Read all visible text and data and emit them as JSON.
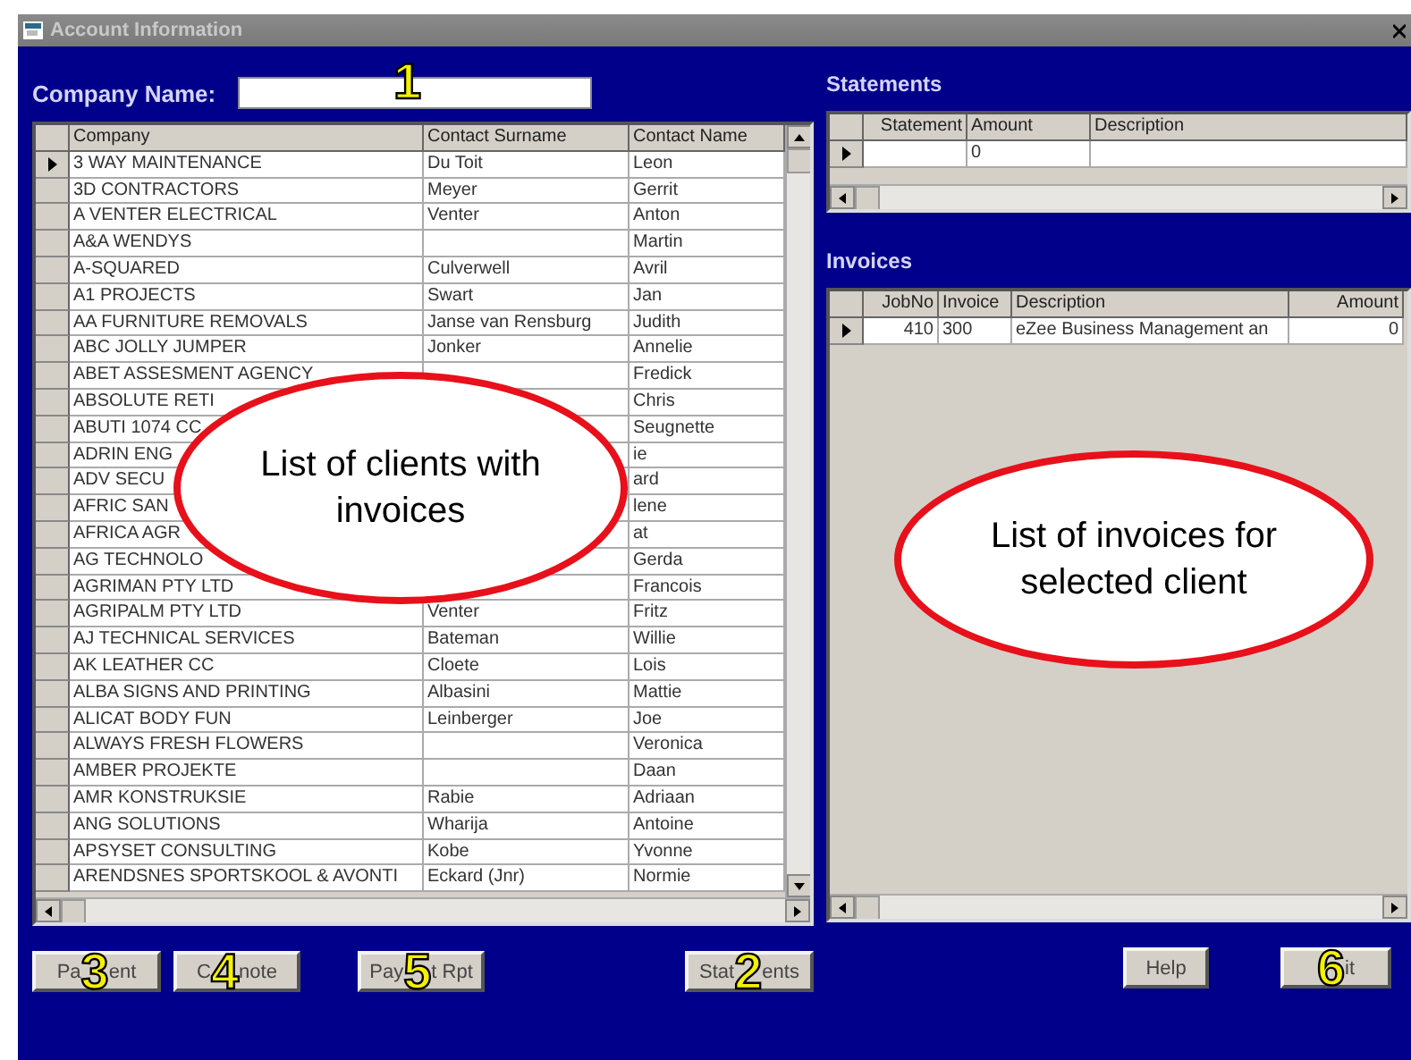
{
  "window": {
    "title": "Account Information"
  },
  "company_name": {
    "label": "Company Name:",
    "marker": "1"
  },
  "clients": {
    "columns": [
      "Company",
      "Contact Surname",
      "Contact Name"
    ],
    "rows": [
      {
        "company": "3 WAY MAINTENANCE",
        "surname": "Du Toit",
        "name": "Leon",
        "selected": true
      },
      {
        "company": "3D CONTRACTORS",
        "surname": "Meyer",
        "name": "Gerrit",
        "selected": false
      },
      {
        "company": "A VENTER ELECTRICAL",
        "surname": "Venter",
        "name": "Anton",
        "selected": false
      },
      {
        "company": "A&A WENDYS",
        "surname": "",
        "name": "Martin",
        "selected": false
      },
      {
        "company": "A-SQUARED",
        "surname": "Culverwell",
        "name": "Avril",
        "selected": false
      },
      {
        "company": "A1 PROJECTS",
        "surname": "Swart",
        "name": "Jan",
        "selected": false
      },
      {
        "company": "AA FURNITURE REMOVALS",
        "surname": "Janse van Rensburg",
        "name": "Judith",
        "selected": false
      },
      {
        "company": "ABC JOLLY JUMPER",
        "surname": "Jonker",
        "name": "Annelie",
        "selected": false
      },
      {
        "company": "ABET ASSESMENT AGENCY",
        "surname": "",
        "name": "Fredick",
        "selected": false
      },
      {
        "company": "ABSOLUTE RETI",
        "surname": "",
        "name": "Chris",
        "selected": false
      },
      {
        "company": "ABUTI 1074 CC",
        "surname": "",
        "name": "Seugnette",
        "selected": false
      },
      {
        "company": "ADRIN ENG",
        "surname": "",
        "name": "ie",
        "selected": false
      },
      {
        "company": "ADV SECU",
        "surname": "",
        "name": "ard",
        "selected": false
      },
      {
        "company": "AFRIC SAN",
        "surname": "",
        "name": "lene",
        "selected": false
      },
      {
        "company": "AFRICA AGR",
        "surname": "",
        "name": "at",
        "selected": false
      },
      {
        "company": "AG TECHNOLO",
        "surname": "",
        "name": "Gerda",
        "selected": false
      },
      {
        "company": "AGRIMAN PTY LTD",
        "surname": "",
        "name": "Francois",
        "selected": false
      },
      {
        "company": "AGRIPALM PTY LTD",
        "surname": "Venter",
        "name": "Fritz",
        "selected": false
      },
      {
        "company": "AJ TECHNICAL SERVICES",
        "surname": "Bateman",
        "name": "Willie",
        "selected": false
      },
      {
        "company": "AK LEATHER CC",
        "surname": "Cloete",
        "name": "Lois",
        "selected": false
      },
      {
        "company": "ALBA SIGNS AND PRINTING",
        "surname": "Albasini",
        "name": "Mattie",
        "selected": false
      },
      {
        "company": "ALICAT BODY FUN",
        "surname": "Leinberger",
        "name": "Joe",
        "selected": false
      },
      {
        "company": "ALWAYS FRESH FLOWERS",
        "surname": "",
        "name": "Veronica",
        "selected": false
      },
      {
        "company": "AMBER PROJEKTE",
        "surname": "",
        "name": "Daan",
        "selected": false
      },
      {
        "company": "AMR KONSTRUKSIE",
        "surname": "Rabie",
        "name": "Adriaan",
        "selected": false
      },
      {
        "company": "ANG SOLUTIONS",
        "surname": "Wharija",
        "name": "Antoine",
        "selected": false
      },
      {
        "company": "APSYSET CONSULTING",
        "surname": "Kobe",
        "name": "Yvonne",
        "selected": false
      },
      {
        "company": "ARENDSNES SPORTSKOOL & AVONTI",
        "surname": "Eckard (Jnr)",
        "name": "Normie",
        "selected": false
      }
    ]
  },
  "statements": {
    "title": "Statements",
    "columns": [
      "Statement",
      "Amount",
      "Description"
    ],
    "rows": [
      {
        "cells": [
          "",
          "0",
          ""
        ],
        "selected": true
      }
    ]
  },
  "invoices": {
    "title": "Invoices",
    "columns": [
      "JobNo",
      "Invoice",
      "Description",
      "Amount"
    ],
    "rows": [
      {
        "cells": [
          "410",
          "300",
          "eZee Business Management an",
          "0"
        ],
        "selected": true
      }
    ]
  },
  "left_buttons": [
    {
      "prefix": "Pa",
      "marker": "3",
      "suffix": "ent"
    },
    {
      "prefix": "C",
      "marker": "4",
      "suffix": "note"
    },
    {
      "prefix": "Pay",
      "marker": "5",
      "suffix": "t Rpt"
    },
    {
      "prefix": "Stat",
      "marker": "2",
      "suffix": "ents"
    }
  ],
  "right_buttons": [
    {
      "prefix": "Help"
    },
    {
      "marker": "6",
      "suffix": "it"
    }
  ],
  "callouts": [
    {
      "text": "List of clients with invoices"
    },
    {
      "text": "List of invoices for selected client"
    }
  ]
}
